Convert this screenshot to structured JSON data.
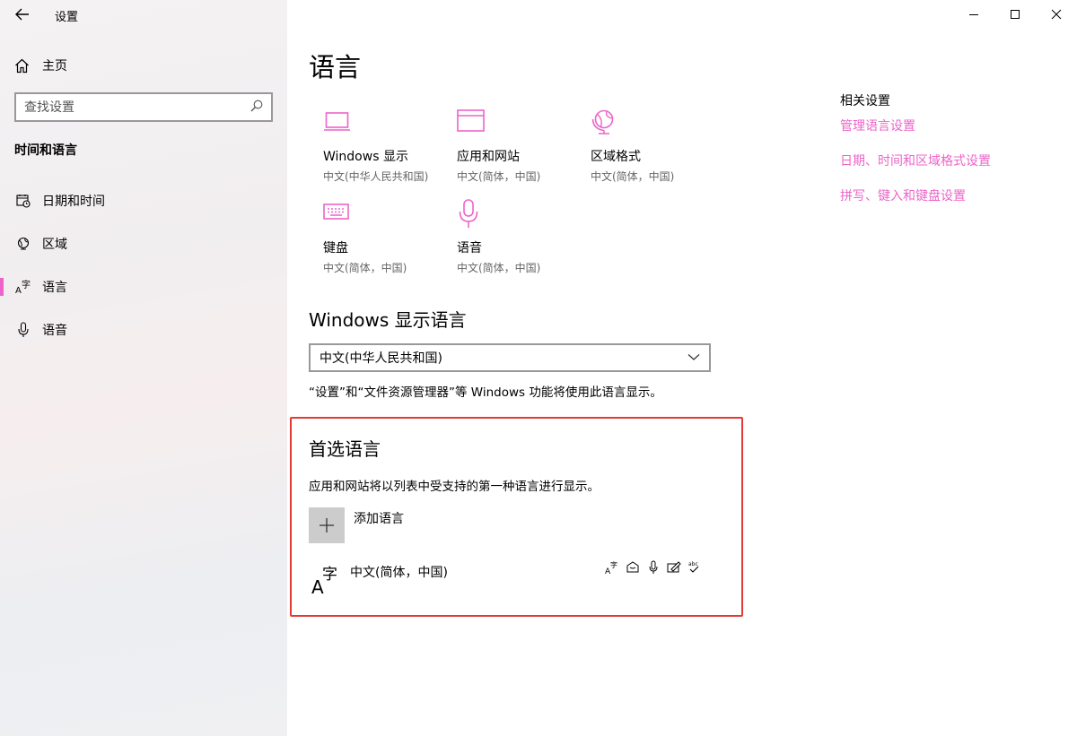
{
  "window": {
    "title": "设置",
    "controls": [
      "minimize-icon",
      "maximize-icon",
      "close-icon"
    ]
  },
  "sidebar": {
    "home_label": "主页",
    "search_placeholder": "查找设置",
    "section_label": "时间和语言",
    "items": [
      {
        "label": "日期和时间",
        "icon": "date-time-icon",
        "active": false
      },
      {
        "label": "区域",
        "icon": "globe-icon",
        "active": false
      },
      {
        "label": "语言",
        "icon": "language-icon",
        "active": true
      },
      {
        "label": "语音",
        "icon": "microphone-icon",
        "active": false
      }
    ],
    "accent_color": "#ec64c9"
  },
  "main": {
    "title": "语言",
    "tiles": [
      {
        "name": "Windows 显示",
        "sub": "中文(中华人民共和国)",
        "icon": "laptop-icon"
      },
      {
        "name": "应用和网站",
        "sub": "中文(简体，中国)",
        "icon": "browser-window-icon"
      },
      {
        "name": "区域格式",
        "sub": "中文(简体，中国)",
        "icon": "globe-icon"
      },
      {
        "name": "键盘",
        "sub": "中文(简体，中国)",
        "icon": "keyboard-icon"
      },
      {
        "name": "语音",
        "sub": "中文(简体，中国)",
        "icon": "microphone-icon"
      }
    ],
    "display_language": {
      "heading": "Windows 显示语言",
      "selected": "中文(中华人民共和国)",
      "note": "“设置”和“文件资源管理器”等 Windows 功能将使用此语言显示。"
    },
    "preferred": {
      "heading": "首选语言",
      "description": "应用和网站将以列表中受支持的第一种语言进行显示。",
      "add_label": "添加语言",
      "languages": [
        {
          "name": "中文(简体，中国)",
          "features": [
            "display-language-icon",
            "speech-recognition-icon",
            "microphone-icon",
            "handwriting-icon",
            "spellcheck-icon"
          ]
        }
      ]
    }
  },
  "related": {
    "heading": "相关设置",
    "links": [
      "管理语言设置",
      "日期、时间和区域格式设置",
      "拼写、键入和键盘设置"
    ],
    "link_color": "#ec64c9"
  },
  "highlight_color": "#e53935"
}
